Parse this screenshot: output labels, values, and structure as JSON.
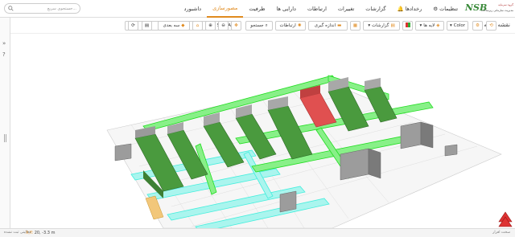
{
  "search": {
    "placeholder": "جستجوی سریع..."
  },
  "nav": [
    {
      "label": "تنظیمات",
      "icon": "gear"
    },
    {
      "label": "رخدادها",
      "icon": "bell"
    },
    {
      "label": "گزارشات"
    },
    {
      "label": "تغییرات"
    },
    {
      "label": "ارتباطات"
    },
    {
      "label": "دارایی ها"
    },
    {
      "label": "ظرفیت"
    },
    {
      "label": "مصورسازی",
      "active": true
    },
    {
      "label": "داشبورد"
    }
  ],
  "logo": {
    "mark": "NSB",
    "line1": "گروه سرمایه",
    "line2": "مدیریت سازمانی زیرساخت"
  },
  "page": {
    "title": "نقشه طبقه"
  },
  "site_select": {
    "value": "SITE A"
  },
  "toolbar": {
    "view3d": "سه بعدی",
    "search": "جستجو",
    "links": "ارتباطات",
    "measure": "اندازه گیری",
    "reports": "گزارشات",
    "layers": "لایه ها",
    "color": "Color"
  },
  "colors": {
    "accent": "#e08a1e",
    "rack": "#4a9a3e",
    "tray_green": "#33ee33",
    "tray_cyan": "#44eedd",
    "rack_red": "#e05050",
    "rack_gray": "#9a9a9a"
  },
  "status": {
    "left": "فعالیتی ثبت نشده",
    "coords": "20, -3.3 m",
    "coords_label": "X,Y:",
    "right": "سخت افزار"
  }
}
